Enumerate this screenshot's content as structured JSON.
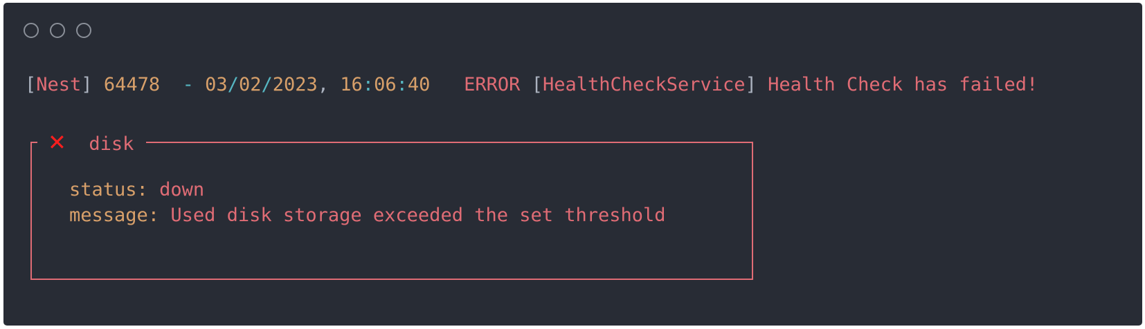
{
  "window": {
    "controls": [
      "circle",
      "circle",
      "circle"
    ]
  },
  "log": {
    "bracket_open": "[",
    "app": "Nest",
    "bracket_close": "]",
    "pid": "64478",
    "dash": "-",
    "date_month": "03",
    "date_sep1": "/",
    "date_day": "02",
    "date_sep2": "/",
    "date_year": "2023",
    "comma": ",",
    "time_h": "16",
    "time_sep1": ":",
    "time_m": "06",
    "time_sep2": ":",
    "time_s": "40",
    "level": "ERROR",
    "context_open": "[",
    "context": "HealthCheckService",
    "context_close": "]",
    "message": "Health Check has failed!"
  },
  "box": {
    "icon": "cross-mark-icon",
    "icon_glyph": "✕",
    "title": "disk",
    "rows": [
      {
        "key": "status:",
        "value": "down"
      },
      {
        "key": "message:",
        "value": "Used disk storage exceeded the set threshold"
      }
    ]
  },
  "colors": {
    "background": "#282c35",
    "red": "#e06c75",
    "yellow": "#d8a06a",
    "gray": "#abb2bf",
    "cyan": "#56b6c2",
    "error_icon": "#ff1e1e"
  }
}
